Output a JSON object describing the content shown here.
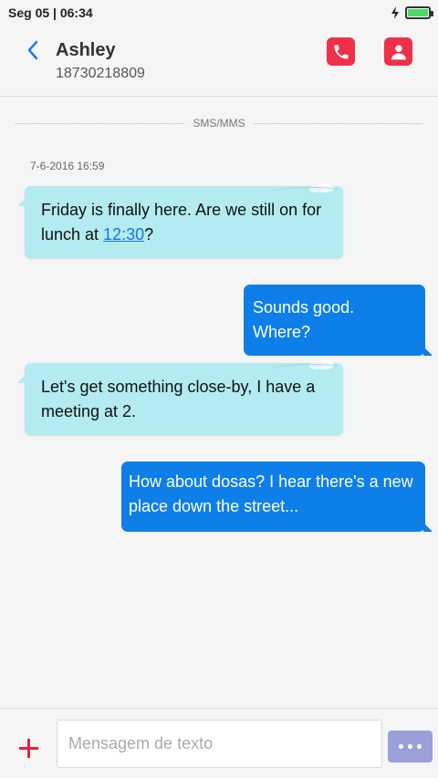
{
  "status_bar": {
    "datetime": "Seg 05 | 06:34",
    "battery_level": 1.0,
    "charging": true
  },
  "header": {
    "contact_name": "Ashley",
    "contact_number": "18730218809",
    "icons": {
      "back": "chevron-left-icon",
      "call": "phone-icon",
      "contact": "person-icon"
    },
    "accent_color": "#f0304a"
  },
  "thread": {
    "channel_label": "SMS/MMS",
    "timestamp": "7-6-2016 16:59",
    "messages": [
      {
        "direction": "incoming",
        "before": "Friday is finally here. Are we still on for lunch at ",
        "link": "12:30",
        "after": "?"
      },
      {
        "direction": "outgoing",
        "text": "Sounds good. Where?"
      },
      {
        "direction": "incoming",
        "text": "Let's get something close-by, I have a meeting at 2."
      },
      {
        "direction": "outgoing",
        "text": "How about dosas? I hear there's a new place down the street..."
      }
    ],
    "colors": {
      "incoming": "#b3ebf0",
      "outgoing": "#0e7fe9"
    }
  },
  "composer": {
    "placeholder": "Mensagem de texto",
    "value": "",
    "icons": {
      "add": "plus-icon",
      "more": "more-dots-icon"
    }
  }
}
